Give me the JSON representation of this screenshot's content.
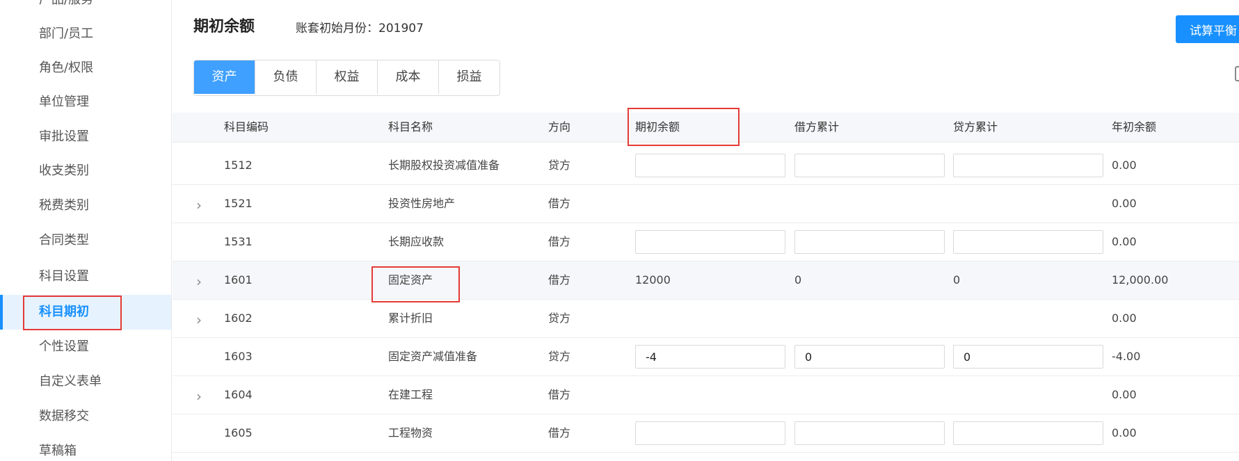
{
  "sidebar": {
    "items": [
      "产品/服务",
      "部门/员工",
      "角色/权限",
      "单位管理",
      "审批设置",
      "收支类别",
      "税费类别",
      "合同类型",
      "科目设置",
      "科目期初",
      "个性设置",
      "自定义表单",
      "数据移交",
      "草稿箱"
    ],
    "active": "科目期初"
  },
  "header": {
    "title": "期初余额",
    "start_month": "账套初始月份：201907",
    "trial_button": "试算平衡"
  },
  "tabs": [
    "资产",
    "负债",
    "权益",
    "成本",
    "损益"
  ],
  "active_tab": "资产",
  "columns": [
    "科目编码",
    "科目名称",
    "方向",
    "期初余额",
    "借方累计",
    "贷方累计",
    "年初余额"
  ],
  "rows": [
    {
      "code": "1512",
      "name": "长期股权投资减值准备",
      "direction": "贷方",
      "expandable": false,
      "editable": true,
      "opening": "",
      "debit": "",
      "credit": "",
      "year_start": "0.00"
    },
    {
      "code": "1521",
      "name": "投资性房地产",
      "direction": "借方",
      "expandable": true,
      "editable": false,
      "opening": "",
      "debit": "",
      "credit": "",
      "year_start": "0.00"
    },
    {
      "code": "1531",
      "name": "长期应收款",
      "direction": "借方",
      "expandable": false,
      "editable": true,
      "opening": "",
      "debit": "",
      "credit": "",
      "year_start": "0.00"
    },
    {
      "code": "1601",
      "name": "固定资产",
      "direction": "借方",
      "expandable": true,
      "editable": false,
      "opening": "12000",
      "debit": "0",
      "credit": "0",
      "year_start": "12,000.00"
    },
    {
      "code": "1602",
      "name": "累计折旧",
      "direction": "贷方",
      "expandable": true,
      "editable": false,
      "opening": "",
      "debit": "",
      "credit": "",
      "year_start": "0.00"
    },
    {
      "code": "1603",
      "name": "固定资产减值准备",
      "direction": "贷方",
      "expandable": false,
      "editable": true,
      "opening": "-4",
      "debit": "0",
      "credit": "0",
      "year_start": "-4.00"
    },
    {
      "code": "1604",
      "name": "在建工程",
      "direction": "借方",
      "expandable": true,
      "editable": false,
      "opening": "",
      "debit": "",
      "credit": "",
      "year_start": "0.00"
    },
    {
      "code": "1605",
      "name": "工程物资",
      "direction": "借方",
      "expandable": false,
      "editable": true,
      "opening": "",
      "debit": "",
      "credit": "",
      "year_start": "0.00"
    }
  ],
  "colors": {
    "accent": "#1890ff",
    "highlight_box": "#e53935"
  }
}
